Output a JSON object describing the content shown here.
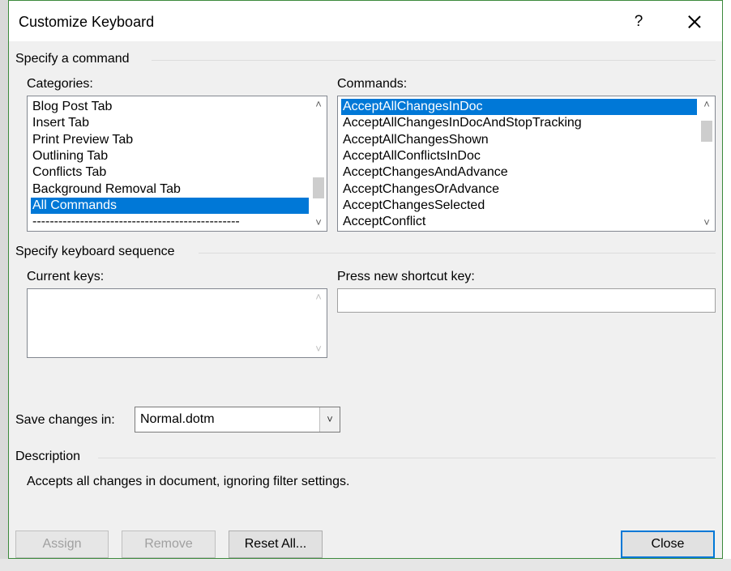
{
  "dialog": {
    "title": "Customize Keyboard",
    "help_label": "?"
  },
  "specify_command": {
    "group_label": "Specify a command",
    "categories_label": "Categories:",
    "commands_label": "Commands:",
    "categories": [
      "Blog Post Tab",
      "Insert Tab",
      "Print Preview Tab",
      "Outlining Tab",
      "Conflicts Tab",
      "Background Removal Tab",
      "All Commands",
      "------------------------------------------------"
    ],
    "selected_category": "All Commands",
    "commands": [
      "AcceptAllChangesInDoc",
      "AcceptAllChangesInDocAndStopTracking",
      "AcceptAllChangesShown",
      "AcceptAllConflictsInDoc",
      "AcceptChangesAndAdvance",
      "AcceptChangesOrAdvance",
      "AcceptChangesSelected",
      "AcceptConflict"
    ],
    "selected_command": "AcceptAllChangesInDoc"
  },
  "keyboard_sequence": {
    "group_label": "Specify keyboard sequence",
    "current_keys_label": "Current keys:",
    "new_shortcut_label": "Press new shortcut key:",
    "new_shortcut_value": ""
  },
  "save_changes": {
    "label": "Save changes in:",
    "value": "Normal.dotm"
  },
  "description": {
    "group_label": "Description",
    "text": "Accepts all changes in document, ignoring filter settings."
  },
  "buttons": {
    "assign": "Assign",
    "remove": "Remove",
    "reset_all": "Reset All...",
    "close": "Close"
  },
  "colors": {
    "selection": "#0078d7",
    "dialog_bg": "#f0f0f0",
    "border_accent": "#3c8a3c"
  }
}
